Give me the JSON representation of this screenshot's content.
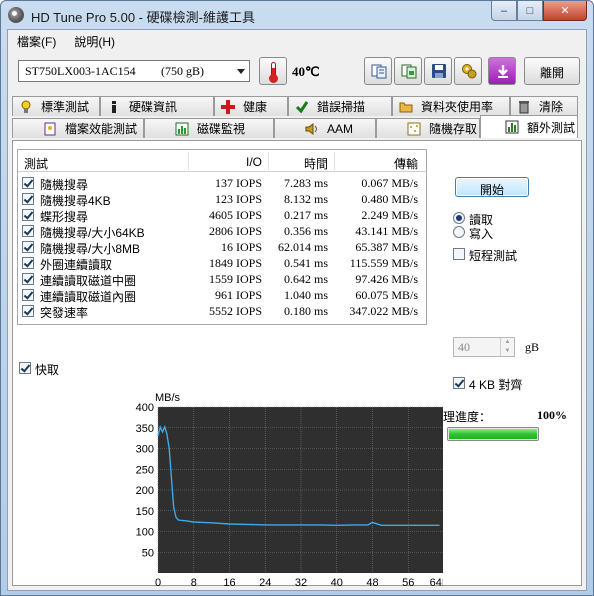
{
  "window": {
    "title": "HD Tune Pro  5.00 - 硬碟檢測-維護工具",
    "min": "–",
    "max": "□",
    "close": "✕"
  },
  "menu": [
    "檔案(F)",
    "說明(H)"
  ],
  "toolbar": {
    "drive": "ST750LX003-1AC154",
    "capacity": "(750 gB)",
    "temperature": "40℃",
    "exit_label": "離開",
    "icons": [
      "copy-text-icon",
      "copy-screenshot-icon",
      "save-icon",
      "options-icon",
      "download-icon"
    ]
  },
  "tabs_top": [
    {
      "label": "標準測試",
      "icon": "lightbulb-icon"
    },
    {
      "label": "硬碟資訊",
      "icon": "info-icon"
    },
    {
      "label": "健康",
      "icon": "health-cross-icon"
    },
    {
      "label": "錯誤掃描",
      "icon": "error-scan-icon"
    },
    {
      "label": "資料夾使用率",
      "icon": "folder-icon"
    },
    {
      "label": "清除",
      "icon": "trash-icon"
    }
  ],
  "tabs_bottom": [
    {
      "label": "檔案效能測試",
      "icon": "file-bench-icon"
    },
    {
      "label": "磁碟監視",
      "icon": "monitor-icon"
    },
    {
      "label": "AAM",
      "icon": "speaker-icon"
    },
    {
      "label": "隨機存取",
      "icon": "random-access-icon"
    },
    {
      "label": "額外測試",
      "icon": "extra-tests-icon",
      "active": true
    }
  ],
  "results": {
    "headers": {
      "test": "測試",
      "io": "I/O",
      "time": "時間",
      "transfer": "傳輸"
    },
    "rows": [
      {
        "name": "隨機搜尋",
        "io": "137 IOPS",
        "time": "7.283 ms",
        "transfer": "0.067 MB/s"
      },
      {
        "name": "隨機搜尋4KB",
        "io": "123 IOPS",
        "time": "8.132 ms",
        "transfer": "0.480 MB/s"
      },
      {
        "name": "蝶形搜尋",
        "io": "4605 IOPS",
        "time": "0.217 ms",
        "transfer": "2.249 MB/s"
      },
      {
        "name": "隨機搜尋/大小64KB",
        "io": "2806 IOPS",
        "time": "0.356 ms",
        "transfer": "43.141 MB/s"
      },
      {
        "name": "隨機搜尋/大小8MB",
        "io": "16 IOPS",
        "time": "62.014 ms",
        "transfer": "65.387 MB/s"
      },
      {
        "name": "外圈連續讀取",
        "io": "1849 IOPS",
        "time": "0.541 ms",
        "transfer": "115.559 MB/s"
      },
      {
        "name": "連續讀取磁道中圈",
        "io": "1559 IOPS",
        "time": "0.642 ms",
        "transfer": "97.426 MB/s"
      },
      {
        "name": "連續讀取磁道內圈",
        "io": "961 IOPS",
        "time": "1.040 ms",
        "transfer": "60.075 MB/s"
      },
      {
        "name": "突發速率",
        "io": "5552 IOPS",
        "time": "0.180 ms",
        "transfer": "347.022 MB/s"
      }
    ]
  },
  "controls": {
    "start": "開始",
    "read": "讀取",
    "write": "寫入",
    "short_test": "短程測試",
    "size_value": "40",
    "size_unit": "gB",
    "align_4kb": "4 KB 對齊",
    "progress_label": "處理進度：",
    "progress_value": "100%",
    "progress_fraction": 1.0,
    "cache": "快取"
  },
  "chart_data": {
    "type": "line",
    "ylabel": "MB/s",
    "xunit": "MB",
    "ylim": [
      0,
      400
    ],
    "xlim": [
      0,
      64
    ],
    "yticks": [
      50,
      100,
      150,
      200,
      250,
      300,
      350,
      400
    ],
    "xticks": [
      0,
      8,
      16,
      24,
      32,
      40,
      48,
      56,
      64
    ],
    "grid": true,
    "background": "#2f2f2f",
    "series_color": "#3fa8e8",
    "x": [
      0,
      0.5,
      1,
      1.5,
      2,
      2.5,
      3,
      3.5,
      4,
      4.5,
      5,
      6,
      8,
      10,
      12,
      16,
      20,
      24,
      28,
      32,
      36,
      40,
      44,
      47,
      48,
      50,
      56,
      60,
      63
    ],
    "y": [
      330,
      352,
      340,
      352,
      335,
      300,
      230,
      160,
      135,
      128,
      127,
      126,
      123,
      122,
      121,
      118,
      117,
      116,
      116,
      116,
      116,
      115,
      116,
      116,
      122,
      115,
      115,
      115,
      115
    ]
  }
}
